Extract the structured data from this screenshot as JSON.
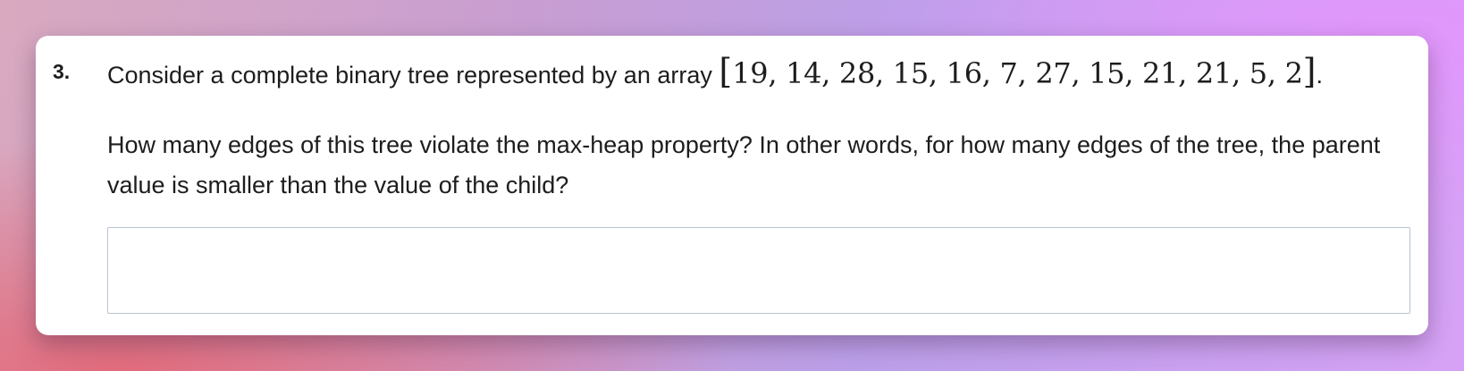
{
  "question": {
    "number": "3.",
    "intro": "Consider a complete binary tree represented by an array ",
    "array_open": "[",
    "array_values": "19, 14, 28, 15, 16, 7, 27, 15, 21, 21, 5, 2",
    "array_close": "]",
    "period": ".",
    "body": "How many edges of this tree violate the max-heap property? In other words, for how many edges of the tree, the parent value is smaller than the value of the child?"
  },
  "answer": {
    "value": "",
    "placeholder": ""
  }
}
